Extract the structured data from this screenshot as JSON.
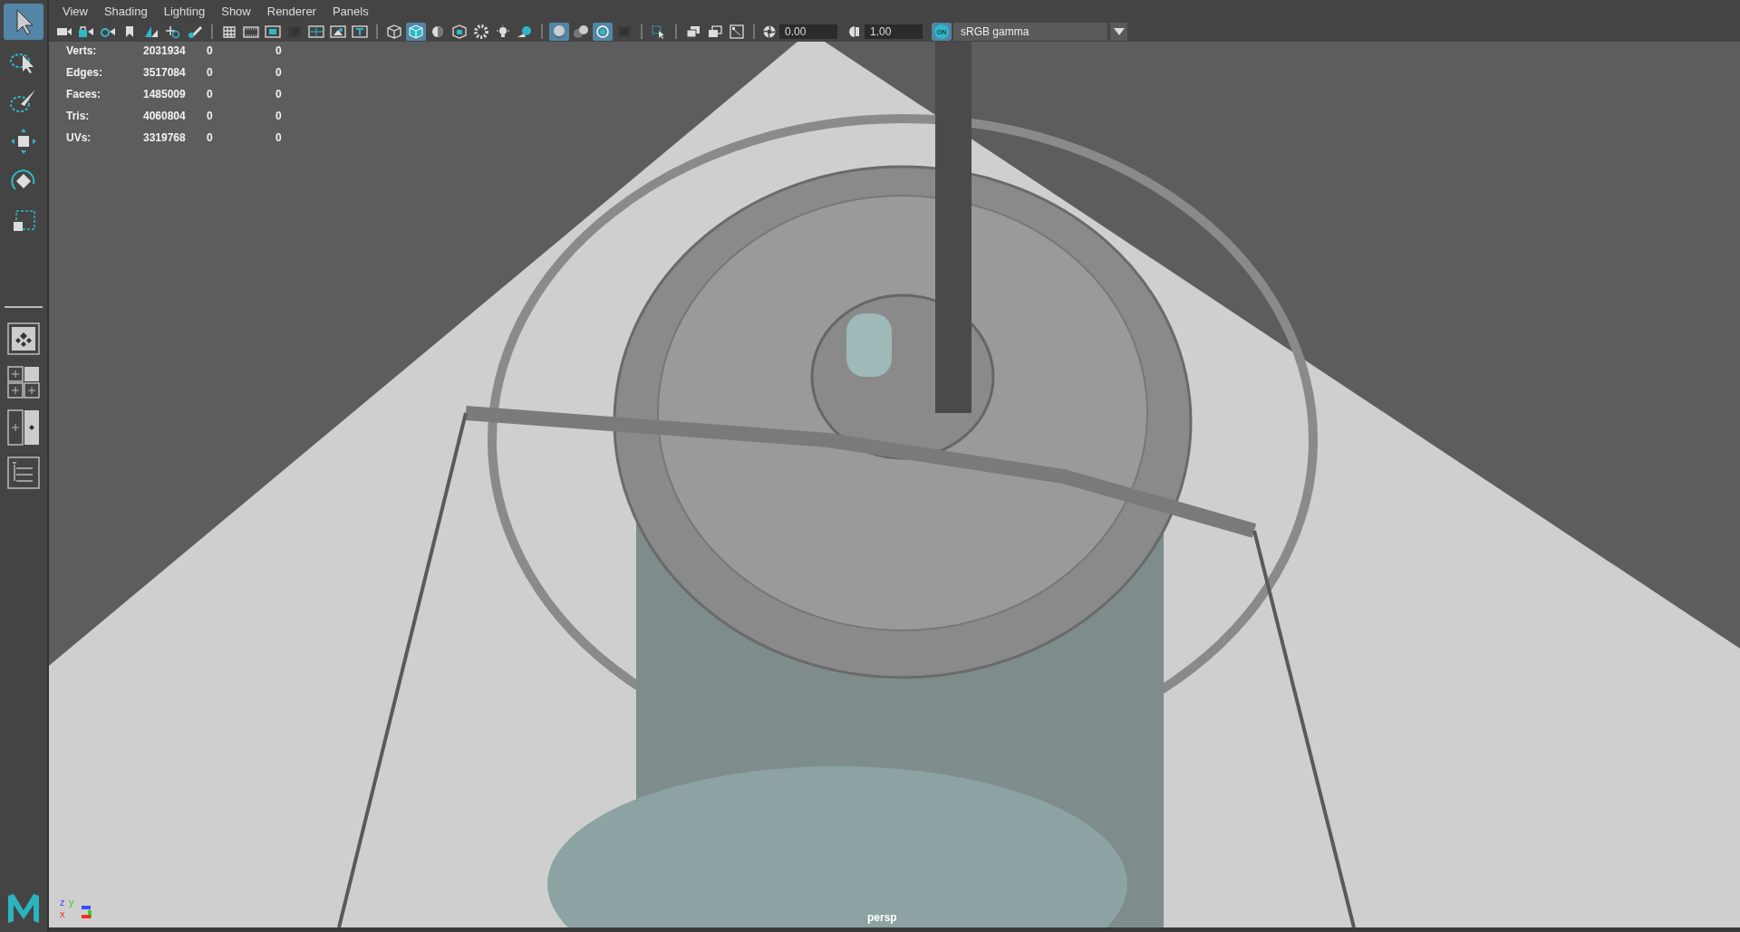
{
  "tools": [
    {
      "kind": "select",
      "selected": true
    },
    {
      "kind": "lasso",
      "selected": false
    },
    {
      "kind": "paint",
      "selected": false
    },
    {
      "kind": "move",
      "selected": false
    },
    {
      "kind": "rotate",
      "selected": false
    },
    {
      "kind": "scale",
      "selected": false
    }
  ],
  "layouts": [
    {
      "kind": "single"
    },
    {
      "kind": "quad"
    },
    {
      "kind": "split"
    },
    {
      "kind": "outliner"
    }
  ],
  "menu": [
    "View",
    "Shading",
    "Lighting",
    "Show",
    "Renderer",
    "Panels"
  ],
  "toolbar": [
    {
      "group": [
        {
          "kind": "camera",
          "selected": false
        },
        {
          "kind": "camera-lock",
          "selected": false
        },
        {
          "kind": "camera-gear",
          "selected": false
        },
        {
          "kind": "bookmark",
          "selected": false
        },
        {
          "kind": "plane",
          "selected": false
        },
        {
          "kind": "pan",
          "selected": false
        },
        {
          "kind": "pencil",
          "selected": false
        }
      ]
    },
    {
      "group": [
        {
          "kind": "grid",
          "selected": false
        },
        {
          "kind": "film",
          "selected": false
        },
        {
          "kind": "gate",
          "selected": false
        },
        {
          "kind": "dark",
          "selected": false
        },
        {
          "kind": "field",
          "selected": false
        },
        {
          "kind": "safe",
          "selected": false
        },
        {
          "kind": "title",
          "selected": false
        }
      ]
    },
    {
      "group": [
        {
          "kind": "wire-cube",
          "selected": false
        },
        {
          "kind": "cube",
          "selected": true
        },
        {
          "kind": "half-sphere",
          "selected": false
        },
        {
          "kind": "tex-cube",
          "selected": false
        },
        {
          "kind": "checker",
          "selected": false
        },
        {
          "kind": "bulb",
          "selected": false
        },
        {
          "kind": "shadow",
          "selected": false
        }
      ]
    },
    {
      "group": [
        {
          "kind": "xray",
          "selected": true
        },
        {
          "kind": "spheres",
          "selected": false
        },
        {
          "kind": "target",
          "selected": true
        },
        {
          "kind": "dark",
          "selected": false
        }
      ]
    },
    {
      "group": [
        {
          "kind": "select-rect",
          "selected": false
        }
      ]
    },
    {
      "group": [
        {
          "kind": "windows",
          "selected": false
        },
        {
          "kind": "window",
          "selected": false
        },
        {
          "kind": "frame",
          "selected": false
        }
      ]
    }
  ],
  "exposure": {
    "value": "0.00"
  },
  "gamma": {
    "value": "1.00"
  },
  "color_management": {
    "label": "ON",
    "on": true
  },
  "view_transform": {
    "value": "sRGB gamma"
  },
  "stats": [
    {
      "label": "Verts:",
      "values": [
        "2031934",
        "0",
        "0"
      ]
    },
    {
      "label": "Edges:",
      "values": [
        "3517084",
        "0",
        "0"
      ]
    },
    {
      "label": "Faces:",
      "values": [
        "1485009",
        "0",
        "0"
      ]
    },
    {
      "label": "Tris:",
      "values": [
        "4060804",
        "0",
        "0"
      ]
    },
    {
      "label": "UVs:",
      "values": [
        "3319768",
        "0",
        "0"
      ]
    }
  ],
  "axes": [
    {
      "label": "z",
      "color": "#3a4cff"
    },
    {
      "label": "y",
      "color": "#2fd02f"
    },
    {
      "label": "x",
      "color": "#ff2a2a"
    }
  ],
  "camera_label": "persp"
}
